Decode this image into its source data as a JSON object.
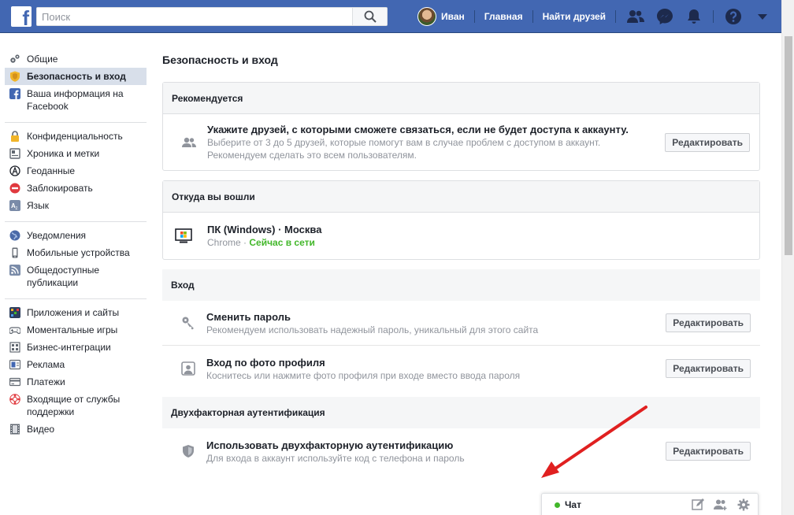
{
  "topbar": {
    "logo_letter": "f",
    "search_placeholder": "Поиск",
    "user_name": "Иван",
    "home": "Главная",
    "find_friends": "Найти друзей"
  },
  "sidebar": {
    "groups": [
      [
        {
          "label": "Общие",
          "icon": "gears-icon"
        },
        {
          "label": "Безопасность и вход",
          "icon": "shield-badge-icon",
          "active": true
        },
        {
          "label": "Ваша информация на Facebook",
          "icon": "facebook-icon"
        }
      ],
      [
        {
          "label": "Конфиденциальность",
          "icon": "lock-icon"
        },
        {
          "label": "Хроника и метки",
          "icon": "timeline-icon"
        },
        {
          "label": "Геоданные",
          "icon": "location-icon"
        },
        {
          "label": "Заблокировать",
          "icon": "block-icon"
        },
        {
          "label": "Язык",
          "icon": "language-icon"
        }
      ],
      [
        {
          "label": "Уведомления",
          "icon": "globe-icon"
        },
        {
          "label": "Мобильные устройства",
          "icon": "mobile-icon"
        },
        {
          "label": "Общедоступные публикации",
          "icon": "rss-icon"
        }
      ],
      [
        {
          "label": "Приложения и сайты",
          "icon": "apps-icon"
        },
        {
          "label": "Моментальные игры",
          "icon": "gamepad-icon"
        },
        {
          "label": "Бизнес-интеграции",
          "icon": "business-icon"
        },
        {
          "label": "Реклама",
          "icon": "ads-icon"
        },
        {
          "label": "Платежи",
          "icon": "card-icon"
        },
        {
          "label": "Входящие от службы поддержки",
          "icon": "lifebuoy-icon"
        },
        {
          "label": "Видео",
          "icon": "film-icon"
        }
      ]
    ]
  },
  "main": {
    "title": "Безопасность и вход",
    "recommended": {
      "header": "Рекомендуется",
      "title": "Укажите друзей, с которыми сможете связаться, если не будет доступа к аккаунту.",
      "desc": "Выберите от 3 до 5 друзей, которые помогут вам в случае проблем с доступом в аккаунт. Рекомендуем сделать это всем пользователям.",
      "button": "Редактировать"
    },
    "where": {
      "header": "Откуда вы вошли",
      "device": "ПК (Windows) · Москва",
      "browser": "Chrome",
      "sep": " · ",
      "status": "Сейчас в сети"
    },
    "login": {
      "header": "Вход",
      "change_pw_title": "Сменить пароль",
      "change_pw_desc": "Рекомендуем использовать надежный пароль, уникальный для этого сайта",
      "change_pw_button": "Редактировать",
      "photo_title": "Вход по фото профиля",
      "photo_desc": "Коснитесь или нажмите фото профиля при входе вместо ввода пароля",
      "photo_button": "Редактировать"
    },
    "twofa": {
      "header": "Двухфакторная аутентификация",
      "title": "Использовать двухфакторную аутентификацию",
      "desc": "Для входа в аккаунт используйте код с телефона и пароль",
      "button": "Редактировать"
    }
  },
  "chat": {
    "label": "Чат"
  },
  "colors": {
    "brand": "#4267b2",
    "online": "#42b72a",
    "arrow": "#e02020"
  }
}
